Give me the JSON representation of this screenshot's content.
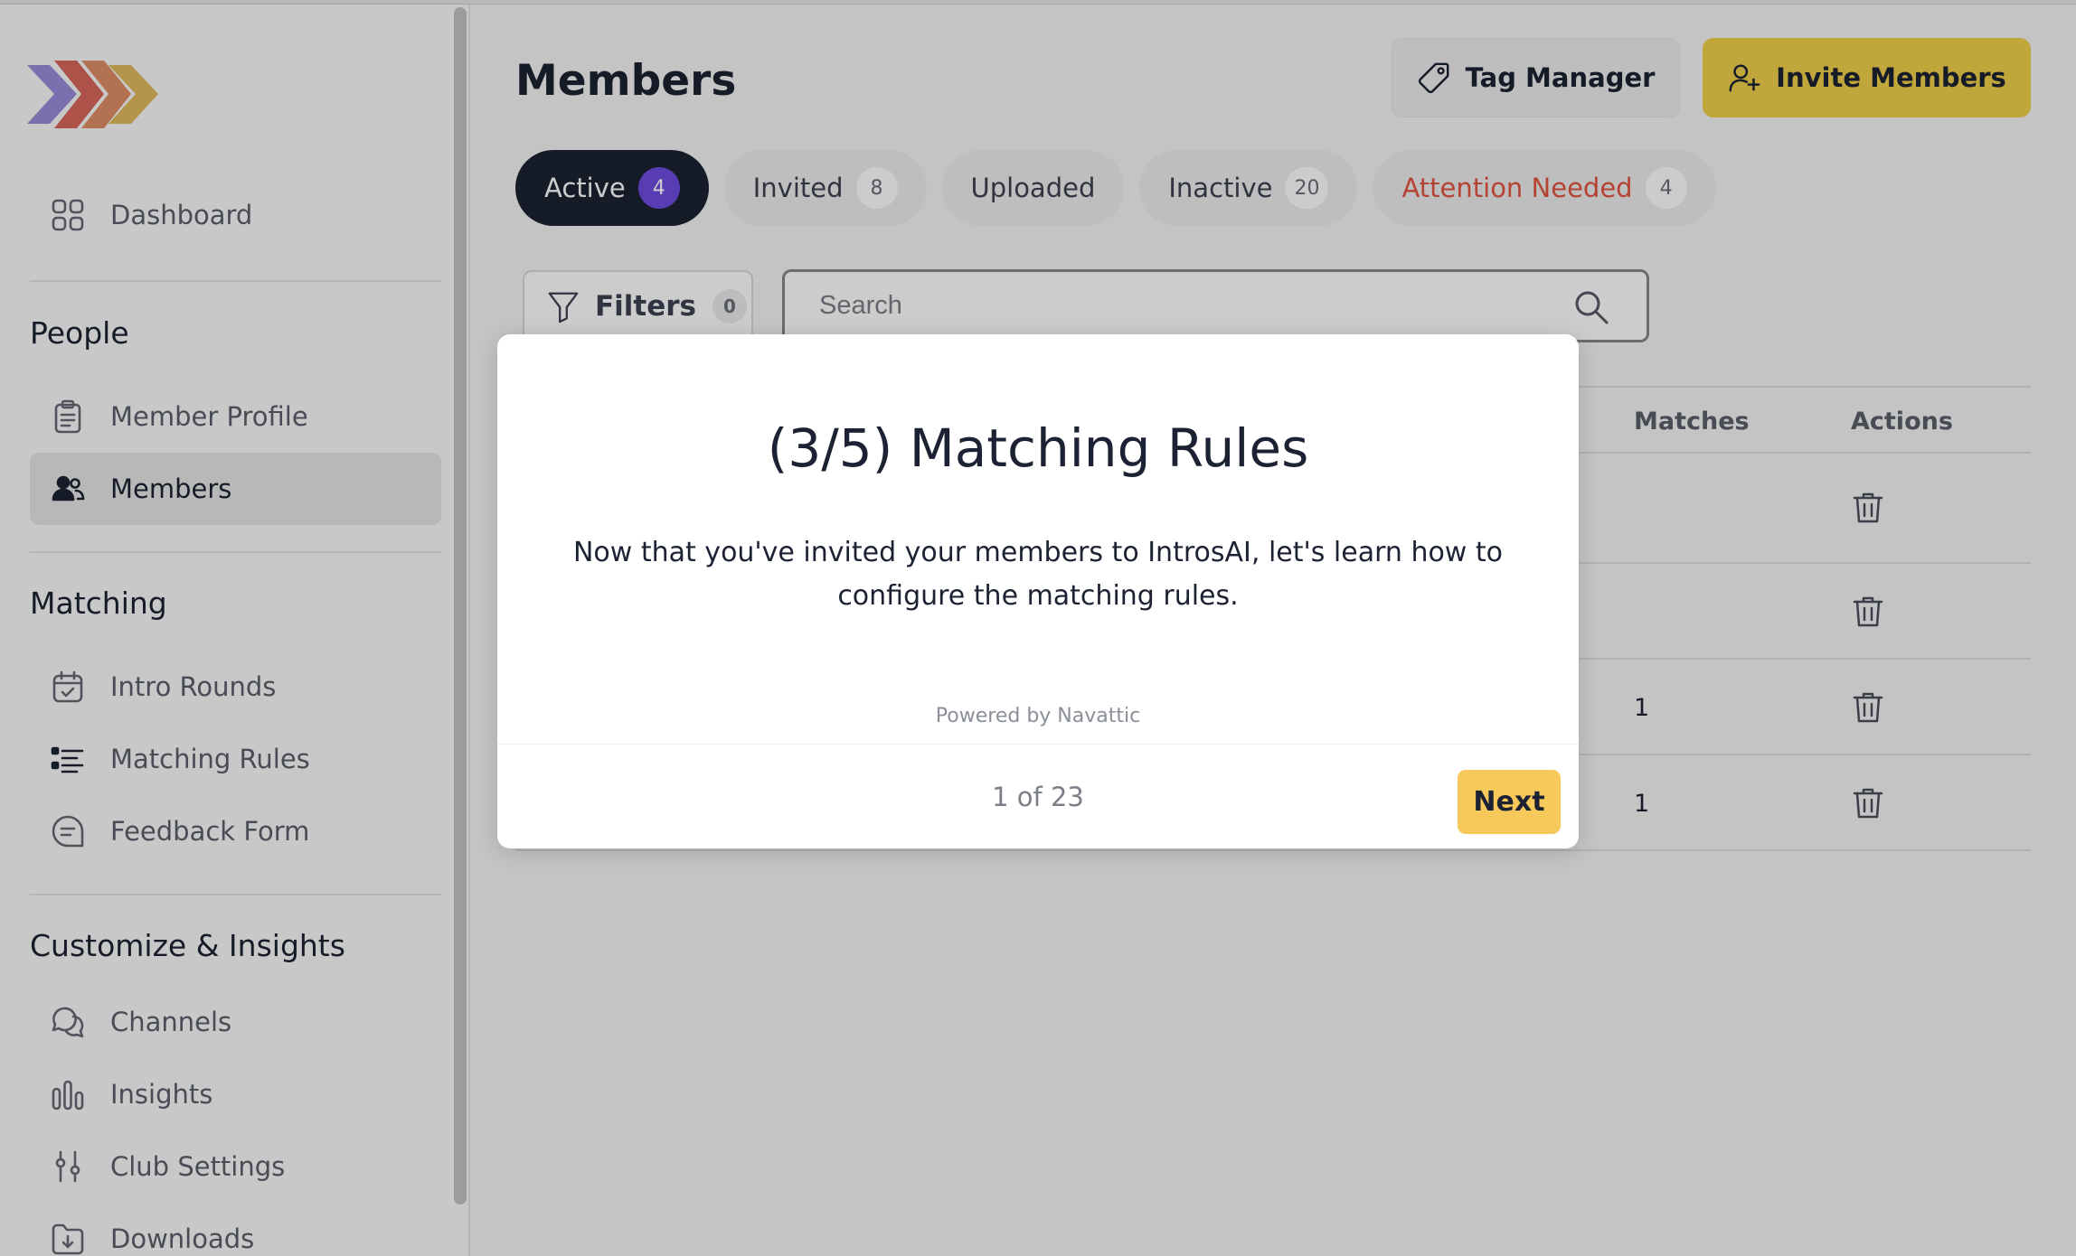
{
  "colors": {
    "accent_yellow": "#f2d04a",
    "next_yellow": "#f7c95a",
    "active_tab": "#1c2233",
    "active_badge": "#6d4ce0",
    "alert_red": "#e35442",
    "logo": [
      "#8e7fd6",
      "#d4574a",
      "#d97a4a",
      "#e0b24e"
    ]
  },
  "sidebar": {
    "dashboard": {
      "label": "Dashboard",
      "icon": "grid-icon"
    },
    "sections": {
      "people": "People",
      "matching": "Matching",
      "customize": "Customize & Insights"
    },
    "people_items": [
      {
        "label": "Member Profile",
        "icon": "clipboard-icon"
      },
      {
        "label": "Members",
        "icon": "users-icon",
        "active": true
      }
    ],
    "matching_items": [
      {
        "label": "Intro Rounds",
        "icon": "calendar-check-icon"
      },
      {
        "label": "Matching Rules",
        "icon": "list-icon"
      },
      {
        "label": "Feedback Form",
        "icon": "message-icon"
      }
    ],
    "customize_items": [
      {
        "label": "Channels",
        "icon": "chat-icon"
      },
      {
        "label": "Insights",
        "icon": "bar-chart-icon"
      },
      {
        "label": "Club Settings",
        "icon": "sliders-icon"
      },
      {
        "label": "Downloads",
        "icon": "folder-download-icon"
      }
    ]
  },
  "header": {
    "title": "Members",
    "tag_manager": "Tag Manager",
    "invite_members": "Invite Members"
  },
  "tabs": [
    {
      "label": "Active",
      "count": "4"
    },
    {
      "label": "Invited",
      "count": "8"
    },
    {
      "label": "Uploaded",
      "count": ""
    },
    {
      "label": "Inactive",
      "count": "20"
    },
    {
      "label": "Attention Needed",
      "count": "4"
    }
  ],
  "filters": {
    "label": "Filters",
    "count": "0"
  },
  "search": {
    "placeholder": "Search"
  },
  "table": {
    "columns": {
      "matches": "Matches",
      "actions": "Actions"
    },
    "rows": [
      {
        "matches": ""
      },
      {
        "matches": ""
      },
      {
        "matches": "1"
      },
      {
        "matches": "1"
      }
    ]
  },
  "modal": {
    "title": "(3/5) Matching Rules",
    "body": "Now that you've invited your members to IntrosAI, let's learn how to configure the matching rules.",
    "powered_by": "Powered by Navattic",
    "step": "1 of 23",
    "next": "Next"
  }
}
